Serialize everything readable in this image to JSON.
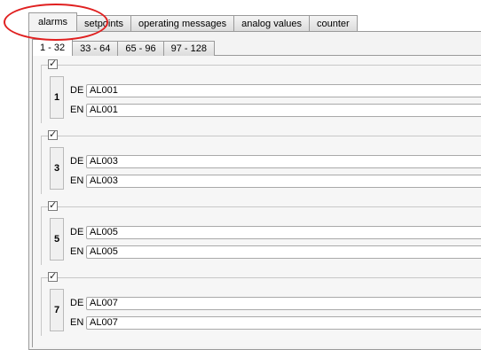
{
  "outer_tabs": [
    "alarms",
    "setpoints",
    "operating messages",
    "analog values",
    "counter"
  ],
  "inner_tabs": [
    "1 - 32",
    "33 - 64",
    "65 - 96",
    "97 - 128"
  ],
  "groups": [
    {
      "number": "1",
      "checked": true,
      "de_label": "DE",
      "de_value": "AL001",
      "en_label": "EN",
      "en_value": "AL001"
    },
    {
      "number": "3",
      "checked": true,
      "de_label": "DE",
      "de_value": "AL003",
      "en_label": "EN",
      "en_value": "AL003"
    },
    {
      "number": "5",
      "checked": true,
      "de_label": "DE",
      "de_value": "AL005",
      "en_label": "EN",
      "en_value": "AL005"
    },
    {
      "number": "7",
      "checked": true,
      "de_label": "DE",
      "de_value": "AL007",
      "en_label": "EN",
      "en_value": "AL007"
    }
  ],
  "colors": {
    "annotation": "#e02020",
    "panel": "#f3f3f3",
    "border": "#9a9a9a"
  },
  "icons": {
    "checkbox": "checkmark-icon"
  }
}
